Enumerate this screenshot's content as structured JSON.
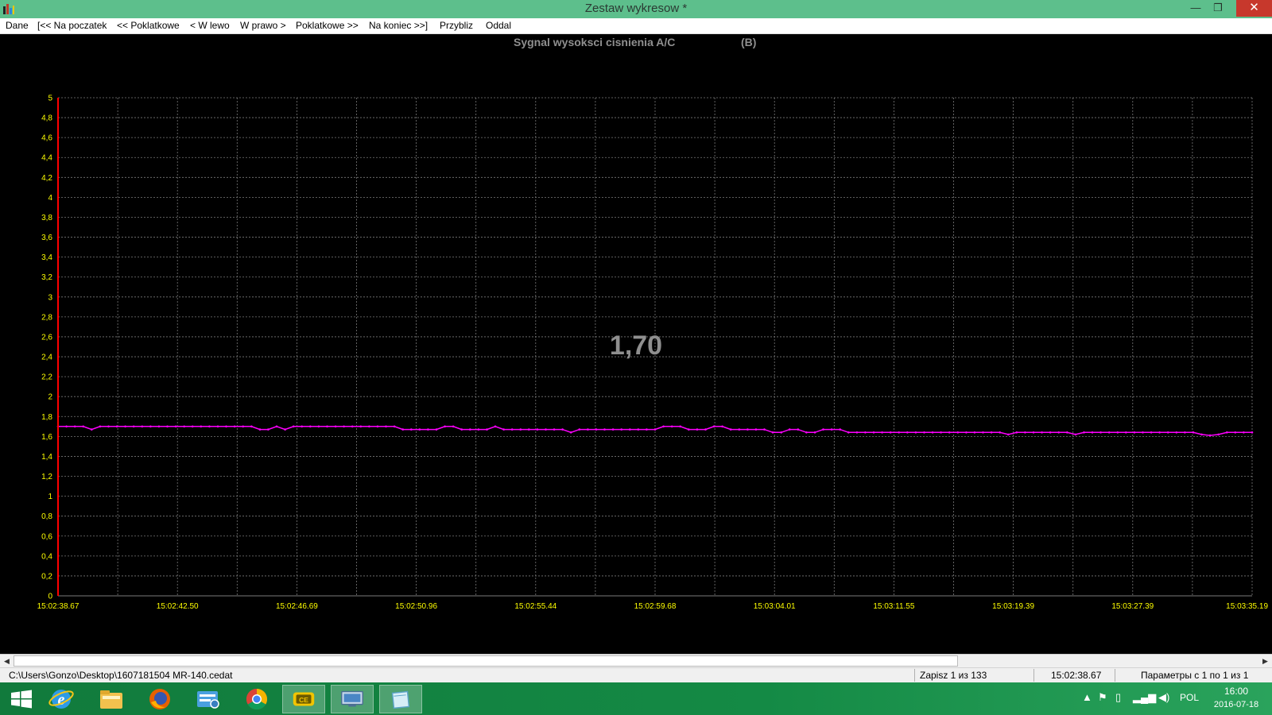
{
  "window": {
    "title": "Zestaw wykresow *",
    "minimize": "—",
    "maximize": "❐",
    "close": "✕"
  },
  "menu": [
    "Dane",
    "[<< Na poczatek",
    "<< Poklatkowe",
    "< W lewo",
    "W prawo >",
    "Poklatkowe >>",
    "Na koniec >>]",
    "Przybliz",
    "Oddal"
  ],
  "chart_data": {
    "type": "line",
    "title": "Sygnal wysoksci cisnienia A/C",
    "unit_label": "(B)",
    "current_value": "1,70",
    "ylim": [
      0,
      5
    ],
    "y_ticks": [
      "0",
      "0,2",
      "0,4",
      "0,6",
      "0,8",
      "1",
      "1,2",
      "1,4",
      "1,6",
      "1,8",
      "2",
      "2,2",
      "2,4",
      "2,6",
      "2,8",
      "3",
      "3,2",
      "3,4",
      "3,6",
      "3,8",
      "4",
      "4,2",
      "4,4",
      "4,6",
      "4,8",
      "5"
    ],
    "x_ticks": [
      "15:02:38.67",
      "15:02:42.50",
      "15:02:46.69",
      "15:02:50.96",
      "15:02:55.44",
      "15:02:59.68",
      "15:03:04.01",
      "15:03:11.55",
      "15:03:19.39",
      "15:03:27.39",
      "15:03:35.19"
    ],
    "grid": true,
    "series": [
      {
        "color": "#ff00ff",
        "values": [
          1.7,
          1.7,
          1.7,
          1.7,
          1.67,
          1.7,
          1.7,
          1.7,
          1.7,
          1.7,
          1.7,
          1.7,
          1.7,
          1.7,
          1.7,
          1.7,
          1.7,
          1.7,
          1.7,
          1.7,
          1.7,
          1.7,
          1.7,
          1.7,
          1.67,
          1.67,
          1.7,
          1.67,
          1.7,
          1.7,
          1.7,
          1.7,
          1.7,
          1.7,
          1.7,
          1.7,
          1.7,
          1.7,
          1.7,
          1.7,
          1.7,
          1.67,
          1.67,
          1.67,
          1.67,
          1.67,
          1.7,
          1.7,
          1.67,
          1.67,
          1.67,
          1.67,
          1.7,
          1.67,
          1.67,
          1.67,
          1.67,
          1.67,
          1.67,
          1.67,
          1.67,
          1.64,
          1.67,
          1.67,
          1.67,
          1.67,
          1.67,
          1.67,
          1.67,
          1.67,
          1.67,
          1.67,
          1.7,
          1.7,
          1.7,
          1.67,
          1.67,
          1.67,
          1.7,
          1.7,
          1.67,
          1.67,
          1.67,
          1.67,
          1.67,
          1.64,
          1.64,
          1.67,
          1.67,
          1.64,
          1.64,
          1.67,
          1.67,
          1.67,
          1.64,
          1.64,
          1.64,
          1.64,
          1.64,
          1.64,
          1.64,
          1.64,
          1.64,
          1.64,
          1.64,
          1.64,
          1.64,
          1.64,
          1.64,
          1.64,
          1.64,
          1.64,
          1.64,
          1.62,
          1.64,
          1.64,
          1.64,
          1.64,
          1.64,
          1.64,
          1.64,
          1.62,
          1.64,
          1.64,
          1.64,
          1.64,
          1.64,
          1.64,
          1.64,
          1.64,
          1.64,
          1.64,
          1.64,
          1.64,
          1.64,
          1.64,
          1.62,
          1.61,
          1.62,
          1.64,
          1.64,
          1.64,
          1.64
        ]
      }
    ],
    "colors": {
      "background": "#000000",
      "grid": "#7a7a7a",
      "axis": "#ff0000",
      "tick_label": "#ffff00",
      "title": "#8f8f8f"
    }
  },
  "scrollbar": {
    "left": "◀",
    "right": "▶"
  },
  "status": {
    "path": "C:\\Users\\Gonzo\\Desktop\\1607181504 MR-140.cedat",
    "record": "Zapisz 1 из 133",
    "time": "15:02:38.67",
    "params": "Параметры с 1 по 1 из 1"
  },
  "taskbar": {
    "apps": [
      "start-icon",
      "ie-icon",
      "file-explorer-icon",
      "firefox-icon",
      "control-panel-icon",
      "chrome-icon",
      "diagnostic-app-icon",
      "remote-desktop-icon",
      "notes-app-icon"
    ],
    "language": "POL",
    "time": "16:00",
    "date": "2016-07-18"
  }
}
